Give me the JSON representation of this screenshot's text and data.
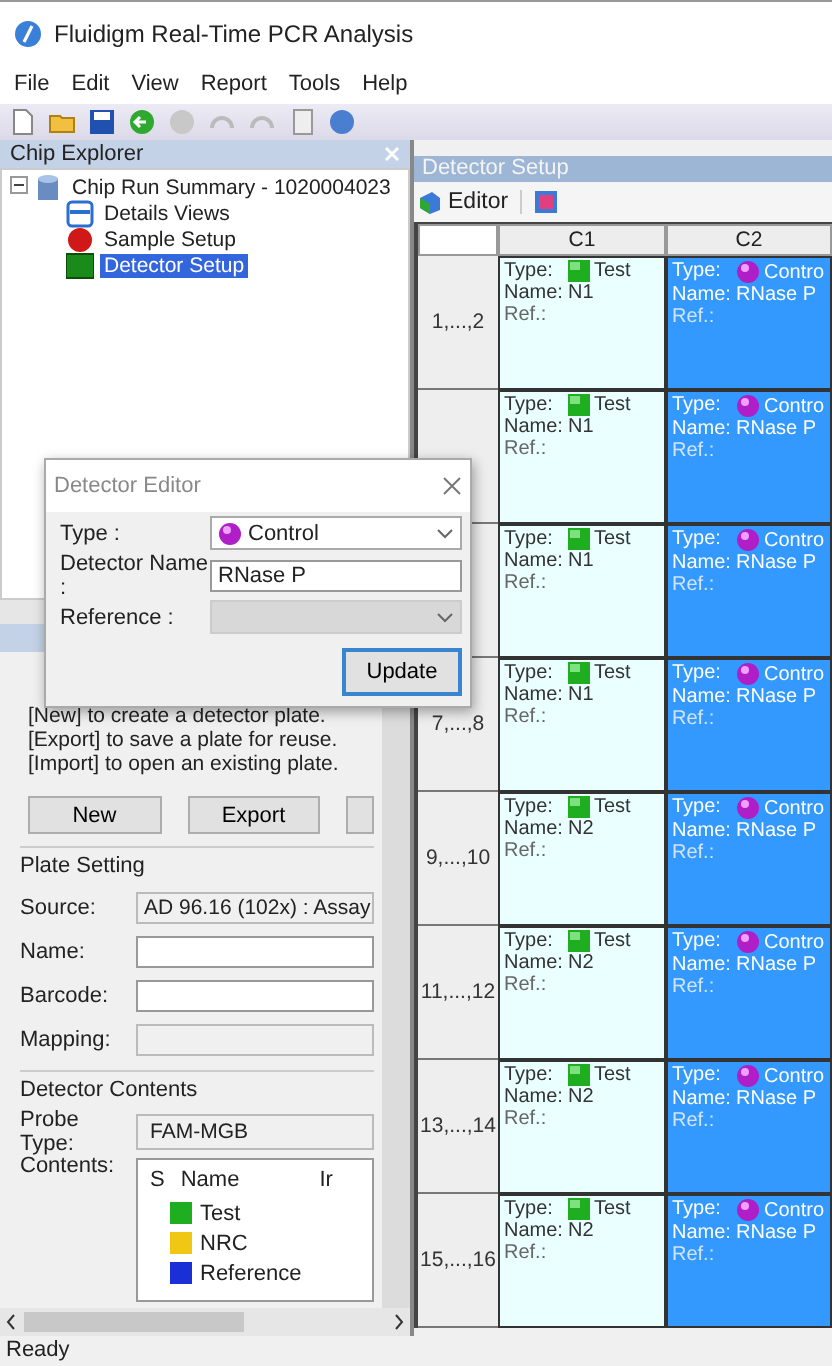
{
  "window": {
    "title": "Fluidigm Real-Time PCR Analysis"
  },
  "menu": [
    "File",
    "Edit",
    "View",
    "Report",
    "Tools",
    "Help"
  ],
  "chip_explorer": {
    "title": "Chip Explorer",
    "tree": [
      {
        "label": "Chip Run Summary - 1020004023",
        "expanded": true,
        "children": [
          {
            "label": "Details Views",
            "kind": "views",
            "selected": false
          },
          {
            "label": "Sample Setup",
            "kind": "sample",
            "selected": false
          },
          {
            "label": "Detector Setup",
            "kind": "detector",
            "selected": true
          }
        ]
      }
    ]
  },
  "tasks": {
    "instructions": [
      "[New] to create a detector plate.",
      "[Export] to save a plate for reuse.",
      "[Import] to open an existing plate."
    ],
    "buttons": [
      "New",
      "Export"
    ],
    "plate_setting": {
      "title": "Plate Setting",
      "fields": [
        {
          "label": "Source:",
          "value": "AD 96.16 (102x) : Assay",
          "disabled": true
        },
        {
          "label": "Name:",
          "disabled": false
        },
        {
          "label": "Barcode:",
          "disabled": false
        },
        {
          "label": "Mapping:",
          "disabled": true
        }
      ]
    },
    "detector_contents": {
      "title": "Detector Contents",
      "probe_type_label": "Probe Type:",
      "probe_type": "FAM-MGB",
      "contents_label": "Contents:",
      "columns": [
        "S",
        "Name",
        "Ir"
      ],
      "items": [
        {
          "name": "Test",
          "color": "#1fae1f"
        },
        {
          "name": "NRC",
          "color": "#f0c814"
        },
        {
          "name": "Reference",
          "color": "#1b2fd6"
        }
      ]
    }
  },
  "detector_setup": {
    "title": "Detector Setup",
    "editor": "Editor",
    "columns": [
      "C1",
      "C2"
    ],
    "rows": [
      {
        "label": "1,...,2",
        "cells": [
          {
            "kind": "test",
            "type_label": "Type:",
            "type": "Test",
            "name_label": "Name:",
            "name": "N1",
            "ref_label": "Ref.:"
          },
          {
            "kind": "control",
            "type_label": "Type:",
            "type": "Contro",
            "name_label": "Name:",
            "name": "RNase P",
            "ref_label": "Ref.:"
          }
        ]
      },
      {
        "cells": [
          {
            "kind": "test",
            "type_label": "Type:",
            "type": "Test",
            "name_label": "Name:",
            "name": "N1",
            "ref_label": "Ref.:"
          },
          {
            "kind": "control",
            "type_label": "Type:",
            "type": "Contro",
            "name_label": "Name:",
            "name": "RNase P",
            "ref_label": "Ref.:"
          }
        ]
      },
      {
        "cells": [
          {
            "kind": "test",
            "type_label": "Type:",
            "type": "Test",
            "name_label": "Name:",
            "name": "N1",
            "ref_label": "Ref.:"
          },
          {
            "kind": "control",
            "type_label": "Type:",
            "type": "Contro",
            "name_label": "Name:",
            "name": "RNase P",
            "ref_label": "Ref.:"
          }
        ]
      },
      {
        "label": "7,...,8",
        "cells": [
          {
            "kind": "test",
            "type_label": "Type:",
            "type": "Test",
            "name_label": "Name:",
            "name": "N1",
            "ref_label": "Ref.:"
          },
          {
            "kind": "control",
            "type_label": "Type:",
            "type": "Contro",
            "name_label": "Name:",
            "name": "RNase P",
            "ref_label": "Ref.:"
          }
        ]
      },
      {
        "label": "9,...,10",
        "cells": [
          {
            "kind": "test",
            "type_label": "Type:",
            "type": "Test",
            "name_label": "Name:",
            "name": "N2",
            "ref_label": "Ref.:"
          },
          {
            "kind": "control",
            "type_label": "Type:",
            "type": "Contro",
            "name_label": "Name:",
            "name": "RNase P",
            "ref_label": "Ref.:"
          }
        ]
      },
      {
        "label": "11,...,12",
        "cells": [
          {
            "kind": "test",
            "type_label": "Type:",
            "type": "Test",
            "name_label": "Name:",
            "name": "N2",
            "ref_label": "Ref.:"
          },
          {
            "kind": "control",
            "type_label": "Type:",
            "type": "Contro",
            "name_label": "Name:",
            "name": "RNase P",
            "ref_label": "Ref.:"
          }
        ]
      },
      {
        "label": "13,...,14",
        "cells": [
          {
            "kind": "test",
            "type_label": "Type:",
            "type": "Test",
            "name_label": "Name:",
            "name": "N2",
            "ref_label": "Ref.:"
          },
          {
            "kind": "control",
            "type_label": "Type:",
            "type": "Contro",
            "name_label": "Name:",
            "name": "RNase P",
            "ref_label": "Ref.:"
          }
        ]
      },
      {
        "label": "15,...,16",
        "cells": [
          {
            "kind": "test",
            "type_label": "Type:",
            "type": "Test",
            "name_label": "Name:",
            "name": "N2",
            "ref_label": "Ref.:"
          },
          {
            "kind": "control",
            "type_label": "Type:",
            "type": "Contro",
            "name_label": "Name:",
            "name": "RNase P",
            "ref_label": "Ref.:"
          }
        ]
      }
    ]
  },
  "dialog": {
    "title": "Detector Editor",
    "type_label": "Type :",
    "type": "Control",
    "kind": "control",
    "name_label": "Detector Name :",
    "name": "RNase P",
    "reference_label": "Reference :",
    "reference_disabled": true,
    "button": "Update"
  },
  "status_bar": "Ready"
}
